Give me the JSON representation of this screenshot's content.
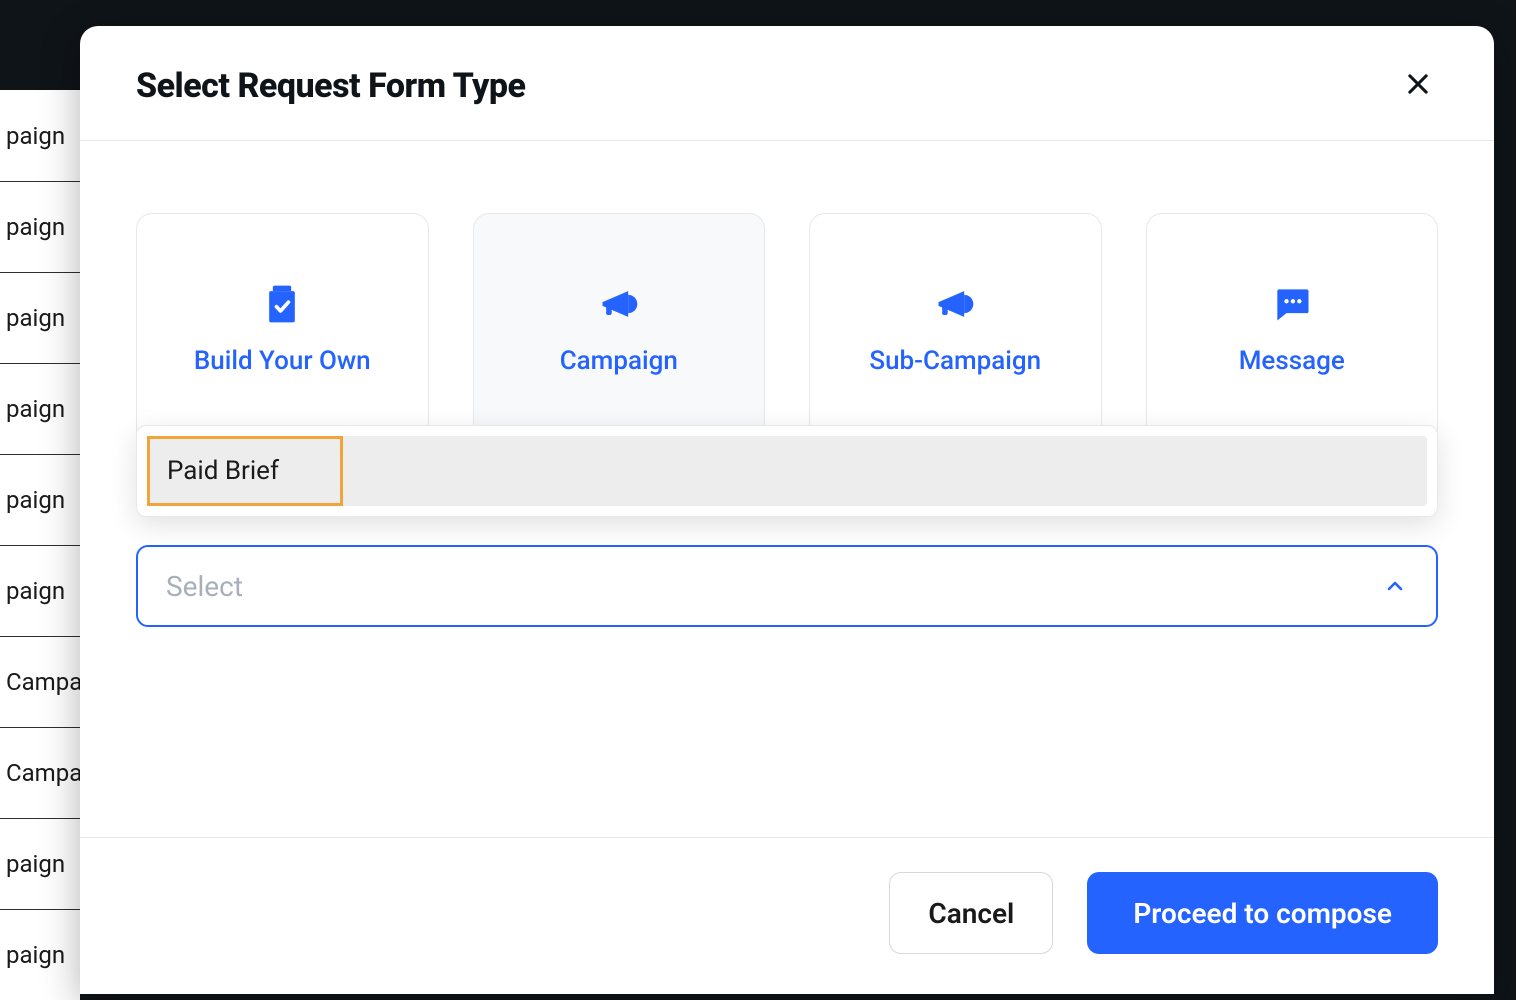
{
  "background_items": [
    "paign",
    "paign",
    "paign",
    "paign",
    "paign",
    "paign",
    "Campaign",
    "Campaign",
    "paign",
    "paign"
  ],
  "modal": {
    "title": "Select Request Form Type",
    "options": [
      {
        "label": "Build Your Own",
        "icon": "clipboard-check"
      },
      {
        "label": "Campaign",
        "icon": "megaphone"
      },
      {
        "label": "Sub-Campaign",
        "icon": "megaphone"
      },
      {
        "label": "Message",
        "icon": "chat"
      }
    ],
    "selected_option_index": 1,
    "dropdown": {
      "placeholder": "Select",
      "open": true,
      "highlighted_option": "Paid Brief",
      "options": [
        "Paid Brief"
      ]
    },
    "footer": {
      "cancel": "Cancel",
      "proceed": "Proceed to compose"
    }
  },
  "colors": {
    "primary": "#2563ff",
    "highlight": "#f0a43a"
  }
}
